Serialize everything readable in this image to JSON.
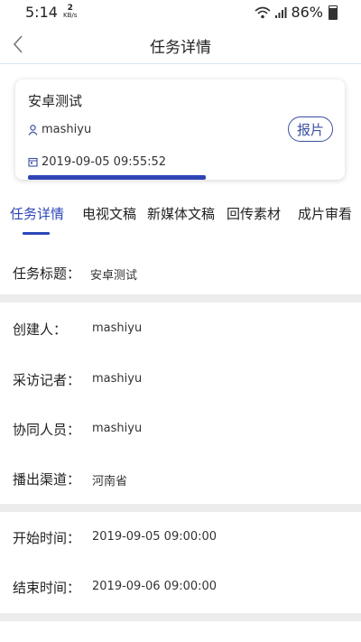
{
  "status": {
    "time": "5:14",
    "speed_value": "2",
    "speed_unit": "KB/s",
    "battery": "86%",
    "wifi_icon": "wifi-icon",
    "signal_icon": "signal-icon",
    "battery_icon": "battery-icon"
  },
  "nav": {
    "title": "任务详情",
    "back_icon": "chevron-left-icon"
  },
  "card": {
    "title": "安卓测试",
    "user": "mashiyu",
    "date": "2019-09-05 09:55:52",
    "report_label": "报片",
    "progress": 0.56,
    "accent": "#2f44b5"
  },
  "tabs": [
    {
      "label": "任务详情",
      "active": true
    },
    {
      "label": "电视文稿",
      "active": false
    },
    {
      "label": "新媒体文稿",
      "active": false
    },
    {
      "label": "回传素材",
      "active": false
    },
    {
      "label": "成片审看",
      "active": false
    }
  ],
  "details": {
    "task_title": {
      "label": "任务标题：",
      "value": "安卓测试"
    },
    "creator": {
      "label": "创建人：",
      "value": "mashiyu"
    },
    "reporter": {
      "label": "采访记者：",
      "value": "mashiyu"
    },
    "collaborators": {
      "label": "协同人员：",
      "value": "mashiyu"
    },
    "channel": {
      "label": "播出渠道：",
      "value": "河南省"
    },
    "start_time": {
      "label": "开始时间：",
      "value": "2019-09-05 09:00:00"
    },
    "end_time": {
      "label": "结束时间：",
      "value": "2019-09-06 09:00:00"
    }
  },
  "colors": {
    "accent": "#2c47b8",
    "divider": "#ececec"
  }
}
